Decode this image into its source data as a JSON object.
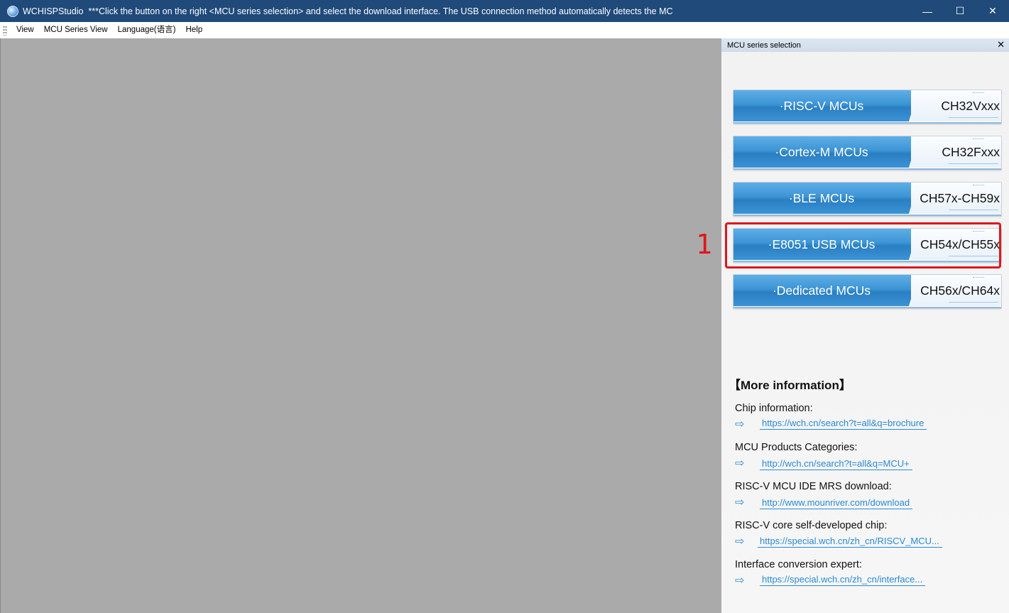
{
  "window": {
    "app_name": "WCHISPStudio",
    "title_message": "***Click the button on the right <MCU series selection> and select the download interface. The USB connection method automatically detects the MC",
    "minimize": "—",
    "maximize": "☐",
    "close": "✕"
  },
  "menu": {
    "items": [
      "View",
      "MCU Series View",
      "Language(语言)",
      "Help"
    ]
  },
  "panel": {
    "title": "MCU series selection",
    "close": "✕",
    "series": [
      {
        "label": "·RISC-V MCUs",
        "chips": "CH32Vxxx"
      },
      {
        "label": "·Cortex-M MCUs",
        "chips": "CH32Fxxx"
      },
      {
        "label": "·BLE MCUs",
        "chips": "CH57x-CH59x"
      },
      {
        "label": "·E8051 USB MCUs",
        "chips": "CH54x/CH55x"
      },
      {
        "label": "·Dedicated MCUs",
        "chips": "CH56x/CH64x"
      }
    ],
    "more_info_title": "【More information】",
    "links": [
      {
        "label": "Chip information:",
        "url": "https://wch.cn/search?t=all&q=brochure"
      },
      {
        "label": "MCU Products Categories:",
        "url": "http://wch.cn/search?t=all&q=MCU+"
      },
      {
        "label": "RISC-V MCU IDE MRS download:",
        "url": "http://www.mounriver.com/download"
      },
      {
        "label": "RISC-V core self-developed chip:",
        "url": "https://special.wch.cn/zh_cn/RISCV_MCU..."
      },
      {
        "label": "Interface conversion expert:",
        "url": "https://special.wch.cn/zh_cn/interface..."
      }
    ],
    "arrow_glyph": "⇨"
  },
  "annotation": {
    "step": "1",
    "color": "#e0161b"
  },
  "colors": {
    "titlebar": "#1f4a7a",
    "button_blue": "#3d95d5",
    "link": "#2a8ad6",
    "workspace": "#abaaab"
  }
}
